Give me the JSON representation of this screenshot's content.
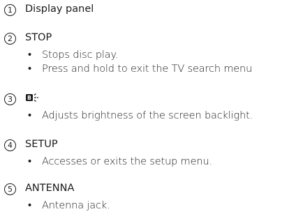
{
  "items": [
    {
      "number": "1",
      "heading": "Display panel",
      "bullets": []
    },
    {
      "number": "2",
      "heading": "STOP",
      "bullets": [
        "Stops disc play.",
        "Press and hold to exit the TV search menu"
      ]
    },
    {
      "number": "3",
      "heading": "",
      "heading_icon": "backlight-icon",
      "bullets": [
        "Adjusts brightness of the screen backlight."
      ]
    },
    {
      "number": "4",
      "heading": "SETUP",
      "bullets": [
        "Accesses or exits the setup menu."
      ]
    },
    {
      "number": "5",
      "heading": "ANTENNA",
      "bullets": [
        "Antenna jack."
      ]
    }
  ],
  "bullet_char": "•"
}
